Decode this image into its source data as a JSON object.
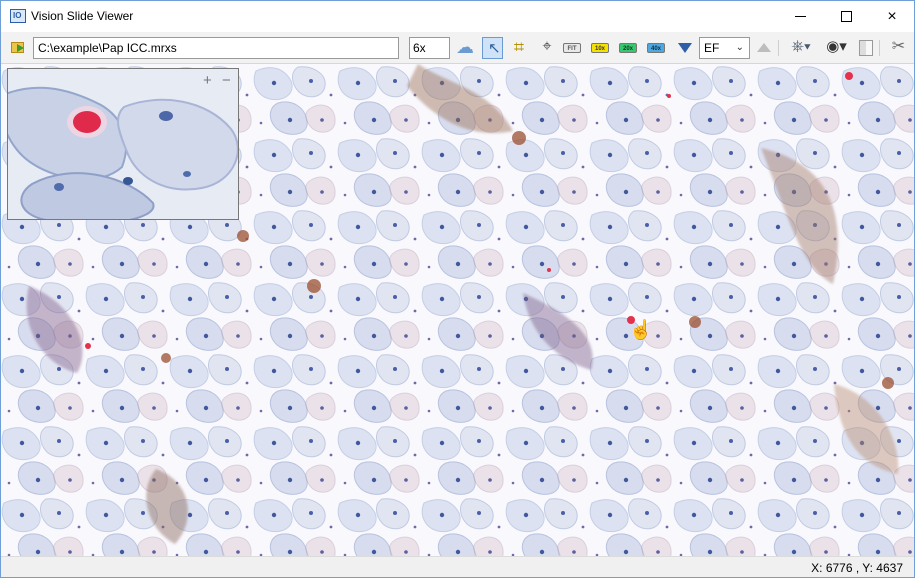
{
  "window": {
    "title": "Vision Slide Viewer",
    "app_icon_text": "IO"
  },
  "window_controls": {
    "minimize": "",
    "maximize": "",
    "close": "×"
  },
  "toolbar": {
    "file_path": "C:\\example\\Pap ICC.mrxs",
    "zoom": "6x",
    "magnifications": [
      "FIT",
      "10x",
      "20x",
      "40x"
    ],
    "filter": "EF"
  },
  "navigator": {
    "plus": "+",
    "minus": "−"
  },
  "status": {
    "coordinates": "X: 6776 , Y: 4637"
  },
  "icons": [
    "open-folder-icon",
    "cloud-icon",
    "select-arrow-icon",
    "crop-icon",
    "target-icon",
    "down-arrow-icon",
    "up-arrow-icon",
    "helm-icon",
    "eye-icon",
    "split-view-icon",
    "tools-icon",
    "hand-cursor-icon"
  ],
  "colors": {
    "title_bar": "#ffffff",
    "accent": "#2e5fa9",
    "select_active": "#cfe3f8"
  }
}
